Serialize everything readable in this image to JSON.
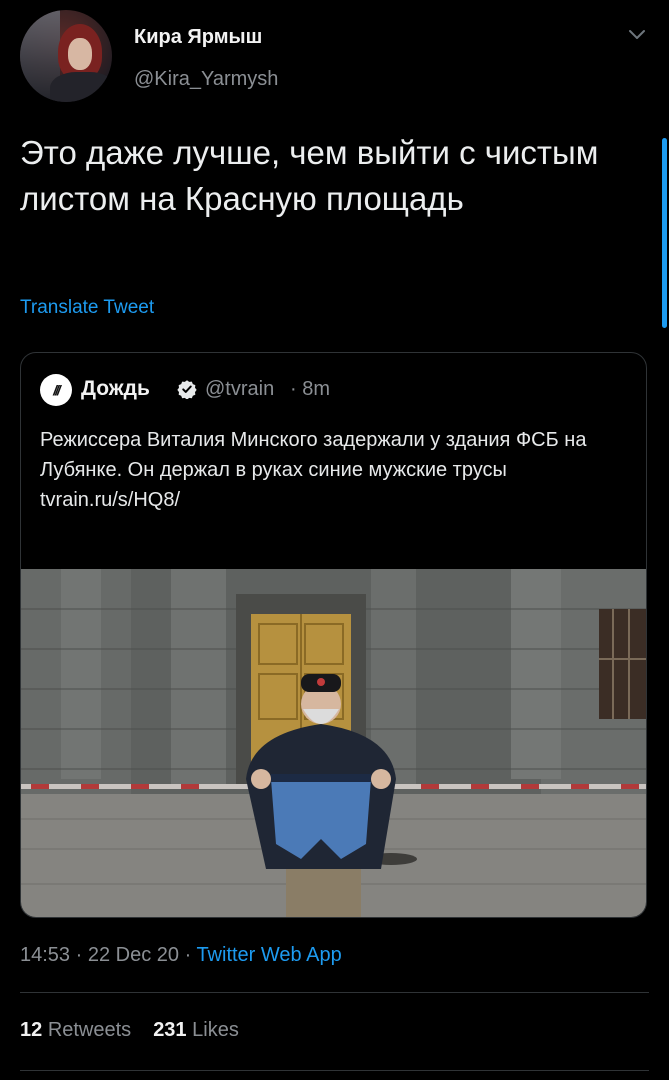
{
  "author": {
    "name": "Кира Ярмыш",
    "handle": "@Kira_Yarmysh",
    "avatar_icon": "profile-photo"
  },
  "tweet": {
    "text": "Это даже лучше, чем выйти с чистым листом на Красную площадь",
    "translate_label": "Translate Tweet",
    "time": "14:53",
    "date": "22 Dec 20",
    "separator": " · ",
    "source_app": "Twitter Web App"
  },
  "quoted": {
    "logo_text": "///",
    "name": "Дождь",
    "handle": "@tvrain",
    "time": "· 8m",
    "text": "Режиссера Виталия Минского задержали у здания ФСБ на Лубянке. Он держал в руках синие мужские трусы",
    "link": "tvrain.ru/s/HQ8/",
    "verified_icon": "verified-badge-icon"
  },
  "stats": {
    "retweets_count": "12",
    "retweets_label": "Retweets",
    "likes_count": "231",
    "likes_label": "Likes"
  },
  "colors": {
    "background": "#000000",
    "accent": "#1d9bf0",
    "muted": "#8b8f94",
    "border": "#2f3336"
  }
}
